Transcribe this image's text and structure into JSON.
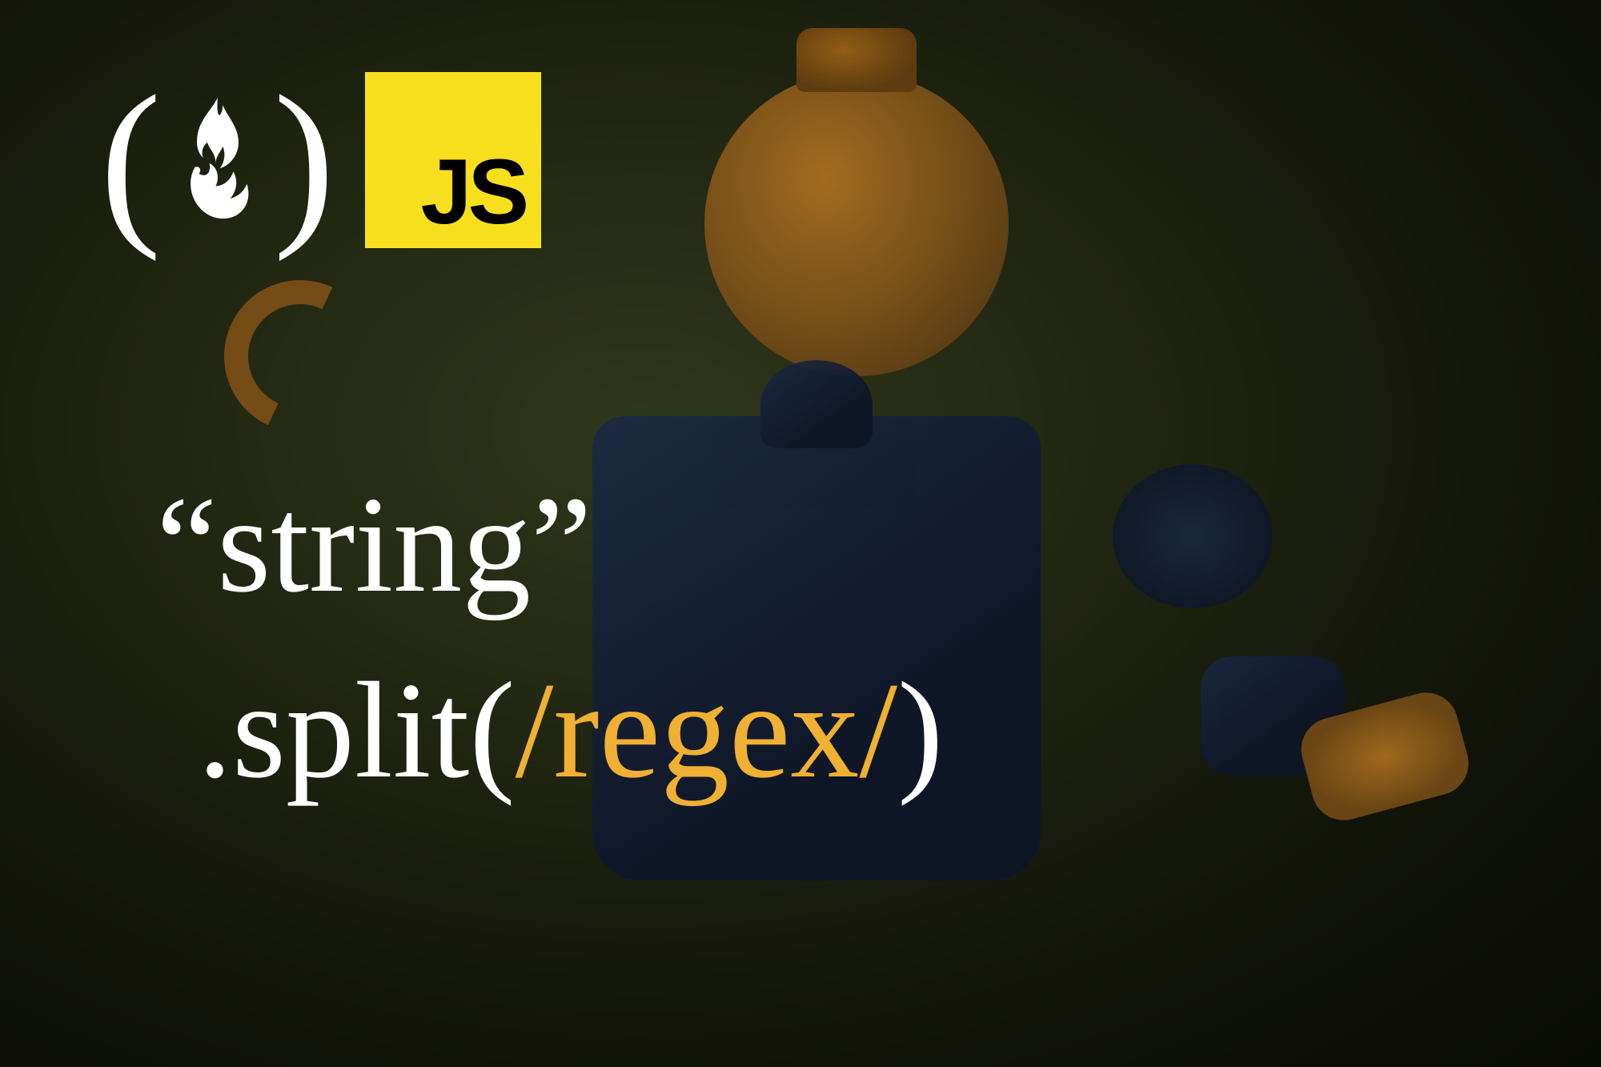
{
  "logos": {
    "fcc_left_paren": "(",
    "fcc_right_paren": ")",
    "js_label": "JS"
  },
  "code": {
    "line1_open_quote": "“",
    "line1_text": "string",
    "line1_close_quote": "”",
    "line2_prefix": ".split(",
    "line2_regex": "/regex/",
    "line2_suffix": ")"
  },
  "colors": {
    "text_primary": "#ffffff",
    "accent": "#f0b033",
    "js_yellow": "#f7df1e",
    "js_text": "#000000"
  }
}
